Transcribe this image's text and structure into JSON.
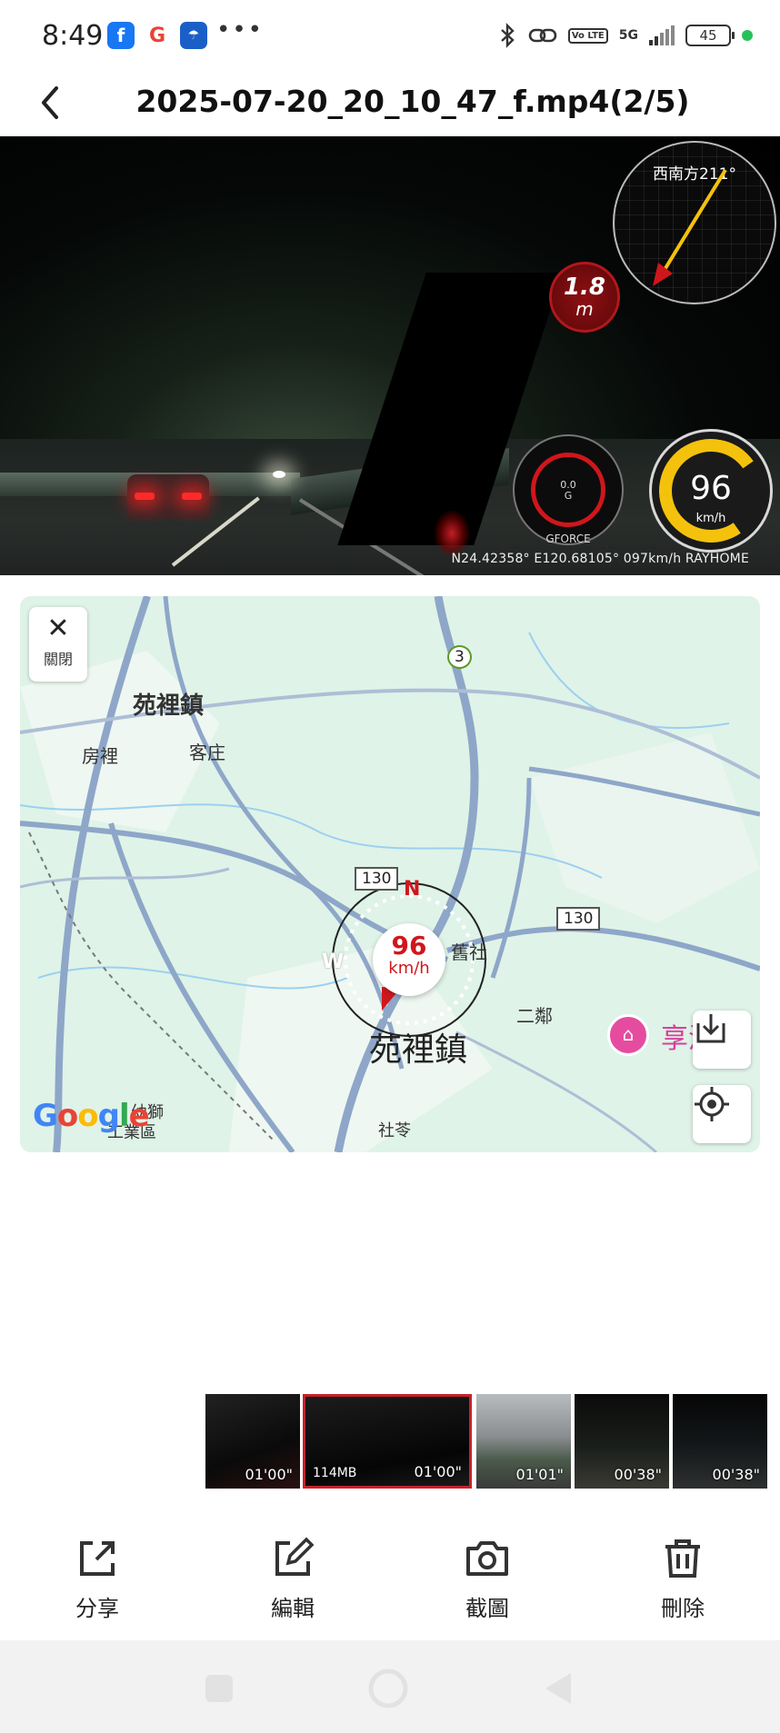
{
  "status_bar": {
    "time": "8:49",
    "network": "5G",
    "volte": "Vo LTE",
    "battery": "45",
    "app_icons": [
      "facebook-icon",
      "google-icon",
      "weather-icon"
    ]
  },
  "header": {
    "title": "2025-07-20_20_10_47_f.mp4(2/5)"
  },
  "video_overlay": {
    "compass_heading": "西南方211°",
    "altitude_value": "1.8",
    "altitude_unit": "m",
    "gforce_value": "0.0",
    "gforce_unit": "G",
    "gforce_label": "GFORCE",
    "speed_value": "96",
    "speed_unit": "km/h",
    "gps_line": "N24.42358° E120.68105° 097km/h  RAYHOME"
  },
  "map": {
    "close_label": "關閉",
    "close_symbol": "✕",
    "labels": {
      "town_top": "苑裡鎮",
      "fangli": "房裡",
      "kezhuang": "客庄",
      "jiushe": "舊社",
      "erlin": "二鄰",
      "town_bottom": "苑裡鎮",
      "shecang": "社苓",
      "industrial_1": "幼獅",
      "industrial_2": "工業區",
      "poi": "享沐"
    },
    "route_shields": {
      "provincial": "3",
      "county_left": "130",
      "county_right": "130"
    },
    "speed_marker_value": "96",
    "speed_marker_unit": "km/h",
    "compass_n": "N",
    "compass_w": "W",
    "google_logo": "Google",
    "colors": {
      "land": "#dff3e8",
      "road": "#8ea6c8",
      "accent_red": "#d0161c"
    }
  },
  "thumbnails": [
    {
      "duration": "01'00\"",
      "size": ""
    },
    {
      "duration": "01'00\"",
      "size": "114MB"
    },
    {
      "duration": "01'01\"",
      "size": ""
    },
    {
      "duration": "00'38\"",
      "size": ""
    },
    {
      "duration": "00'38\"",
      "size": ""
    }
  ],
  "actions": {
    "share": "分享",
    "edit": "編輯",
    "screenshot": "截圖",
    "delete": "刪除"
  }
}
